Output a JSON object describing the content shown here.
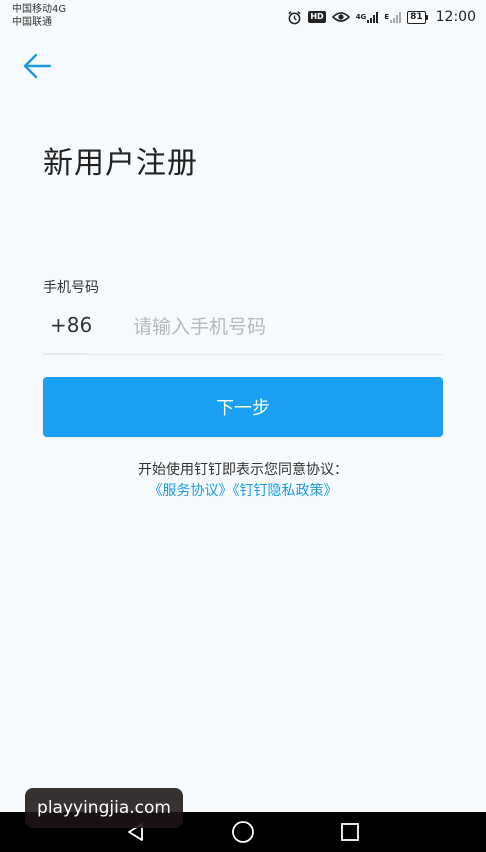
{
  "status_bar": {
    "carrier_1": "中国移动4G",
    "carrier_2": "中国联通",
    "hd": "HD",
    "net_4g": "4G",
    "net_e": "E",
    "battery": "81",
    "time": "12:00"
  },
  "header": {
    "back_icon": "arrow-left-icon"
  },
  "page": {
    "title": "新用户注册"
  },
  "form": {
    "phone_label": "手机号码",
    "country_code": "+86",
    "phone_placeholder": "请输入手机号码",
    "phone_value": ""
  },
  "actions": {
    "next_label": "下一步"
  },
  "agreement": {
    "text": "开始使用钉钉即表示您同意协议：",
    "service_link": "《服务协议》",
    "privacy_link": "《钉钉隐私政策》"
  },
  "watermark": {
    "text": "playyingjia.com"
  },
  "colors": {
    "accent": "#1aa0f2",
    "link": "#1c9be0",
    "background": "#f7fafc"
  }
}
